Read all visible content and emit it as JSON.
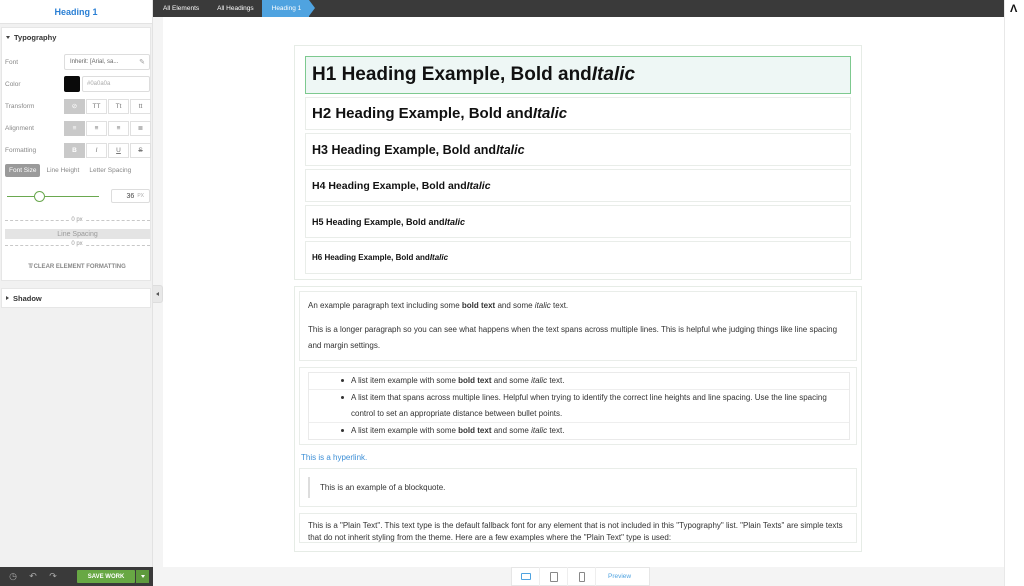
{
  "sidebar": {
    "title": "Heading 1",
    "typography_label": "Typography",
    "font_label": "Font",
    "font_value": "Inherit: [Arial, sa...",
    "color_label": "Color",
    "color_value": "#0a0a0a",
    "transform_label": "Transform",
    "transform_options": [
      "⊘",
      "TT",
      "Tt",
      "tt"
    ],
    "alignment_label": "Alignment",
    "formatting_label": "Formatting",
    "formatting_options": [
      "B",
      "I",
      "U",
      "S"
    ],
    "tabs": [
      "Font Size",
      "Line Height",
      "Letter Spacing"
    ],
    "font_size_value": "36",
    "font_size_unit": "PX",
    "font_size_level": 0.36,
    "top_px": "0 px",
    "spacing_label": "Line Spacing",
    "bottom_px": "0 px",
    "clear_label": "CLEAR ELEMENT FORMATTING",
    "shadow_label": "Shadow",
    "save_label": "SAVE WORK"
  },
  "breadcrumbs": [
    "All Elements",
    "All Headings",
    "Heading 1"
  ],
  "canvas": {
    "headings": [
      {
        "bold": "H1 Heading Example, Bold and ",
        "italic": "Italic"
      },
      {
        "bold": "H2 Heading Example, Bold and ",
        "italic": "Italic"
      },
      {
        "bold": "H3 Heading Example, Bold and ",
        "italic": "Italic"
      },
      {
        "bold": "H4 Heading Example, Bold and ",
        "italic": "Italic"
      },
      {
        "bold": "H5 Heading Example, Bold and ",
        "italic": "Italic"
      },
      {
        "bold": "H6 Heading Example, Bold and ",
        "italic": "Italic"
      }
    ],
    "para1": {
      "a": "An example paragraph text including some ",
      "b": "bold text",
      "c": " and some ",
      "d": "italic",
      "e": " text."
    },
    "para2": "This is a longer paragraph so you can see what happens when the text spans across multiple lines. This is helpful whe judging things like line spacing and margin settings.",
    "list": [
      {
        "a": "A list item example with some ",
        "b": "bold text",
        "c": " and some ",
        "d": "italic",
        "e": " text."
      },
      {
        "a": "A list item that spans across multiple lines. Helpful when trying to identify the correct line heights and line spacing. Use the line spacing control to set an appropriate distance between bullet points.",
        "b": "",
        "c": "",
        "d": "",
        "e": ""
      },
      {
        "a": "A list item example with some ",
        "b": "bold text",
        "c": " and some ",
        "d": "italic",
        "e": " text."
      }
    ],
    "link": "This is a hyperlink.",
    "quote": "This is an example of a blockquote.",
    "plain": "This is a \"Plain Text\". This text type is the default fallback font for any element that is not included in this \"Typography\" list. \"Plain Texts\" are simple texts that do not inherit styling from the theme. Here are a few examples where the \"Plain Text\" type is used:"
  },
  "device_bar": {
    "preview_label": "Preview"
  },
  "colors": {
    "accent": "#4fa3e0",
    "save": "#68a844",
    "selected_border": "#7dc98f"
  }
}
